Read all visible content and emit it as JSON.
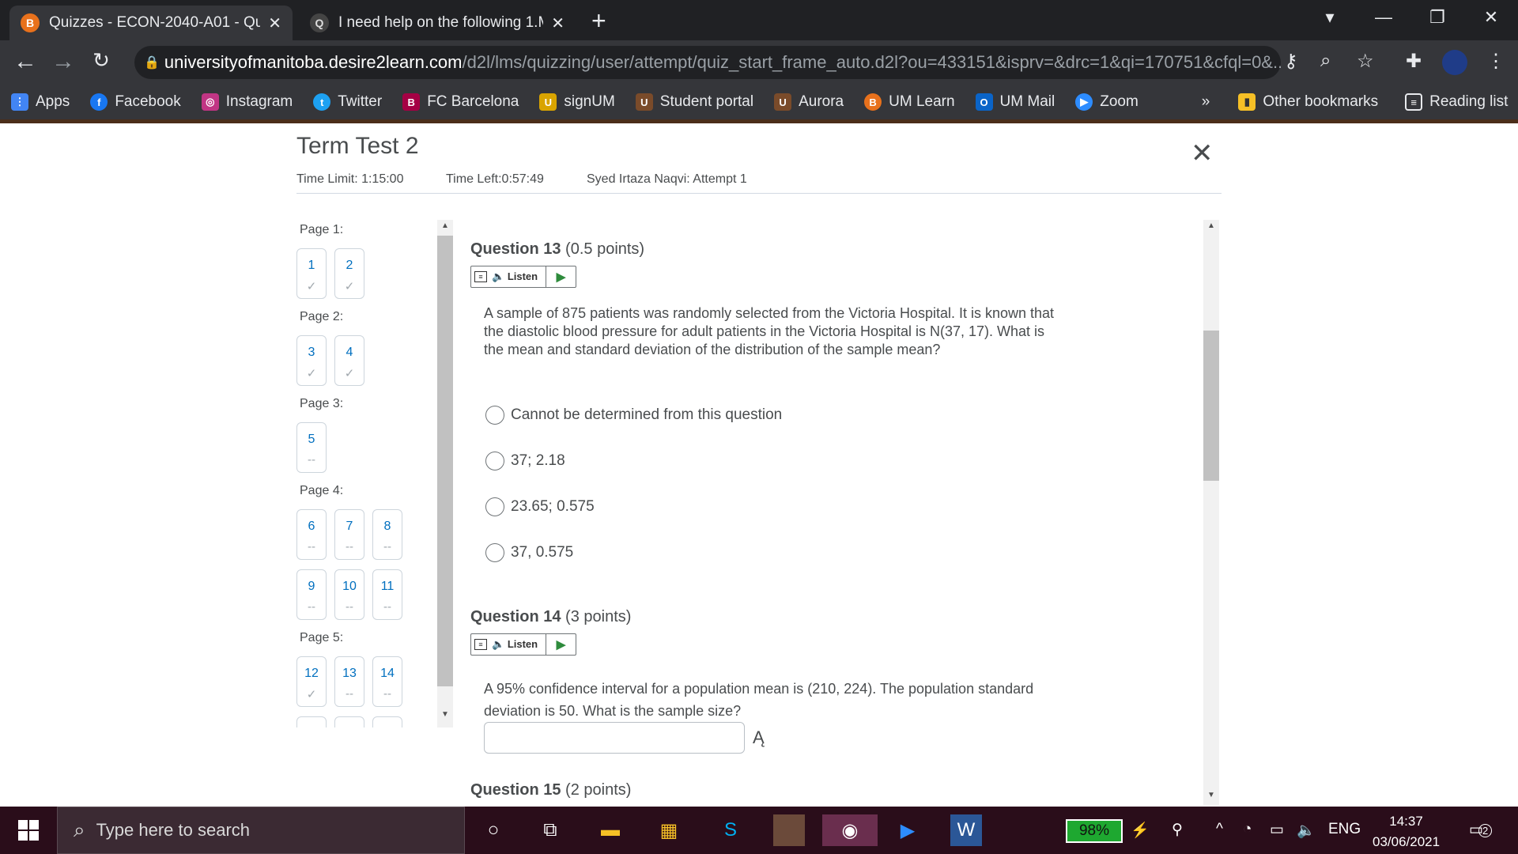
{
  "browser": {
    "tabs": [
      {
        "title": "Quizzes - ECON-2040-A01 - Quar",
        "fav": "B"
      },
      {
        "title": "I need help on the following 1.M",
        "fav": "Q"
      }
    ],
    "url_host": "universityofmanitoba.desire2learn.com",
    "url_path": "/d2l/lms/quizzing/user/attempt/quiz_start_frame_auto.d2l?ou=433151&isprv=&drc=1&qi=170751&cfql=0&...",
    "bookmarks": [
      {
        "label": "Apps",
        "icon": "apps-icon",
        "color": "#4285f4"
      },
      {
        "label": "Facebook",
        "icon": "facebook-icon",
        "color": "#1877f2"
      },
      {
        "label": "Instagram",
        "icon": "instagram-icon",
        "color": "#c13584"
      },
      {
        "label": "Twitter",
        "icon": "twitter-icon",
        "color": "#1da1f2"
      },
      {
        "label": "FC Barcelona",
        "icon": "fcb-icon",
        "color": "#a50044"
      },
      {
        "label": "signUM",
        "icon": "signum-icon",
        "color": "#d9a400"
      },
      {
        "label": "Student portal",
        "icon": "portal-icon",
        "color": "#7a4b2a"
      },
      {
        "label": "Aurora",
        "icon": "aurora-icon",
        "color": "#7a4b2a"
      },
      {
        "label": "UM Learn",
        "icon": "umlearn-icon",
        "color": "#e8711c"
      },
      {
        "label": "UM Mail",
        "icon": "outlook-icon",
        "color": "#0a64c8"
      },
      {
        "label": "Zoom",
        "icon": "zoom-icon",
        "color": "#2d8cff"
      }
    ],
    "more": "»",
    "other_bookmarks": "Other bookmarks",
    "reading_list": "Reading list"
  },
  "quiz": {
    "title": "Term Test 2",
    "time_limit": "Time Limit: 1:15:00",
    "time_left": "Time Left:0:57:49",
    "attempt": "Syed Irtaza Naqvi: Attempt 1",
    "pages": [
      {
        "label": "Page 1:"
      },
      {
        "label": "Page 2:"
      },
      {
        "label": "Page 3:"
      },
      {
        "label": "Page 4:"
      },
      {
        "label": "Page 5:"
      }
    ],
    "questions_nav": [
      {
        "n": "1",
        "status": "✓"
      },
      {
        "n": "2",
        "status": "✓"
      },
      {
        "n": "3",
        "status": "✓"
      },
      {
        "n": "4",
        "status": "✓"
      },
      {
        "n": "5",
        "status": "--"
      },
      {
        "n": "6",
        "status": "--"
      },
      {
        "n": "7",
        "status": "--"
      },
      {
        "n": "8",
        "status": "--"
      },
      {
        "n": "9",
        "status": "--"
      },
      {
        "n": "10",
        "status": "--"
      },
      {
        "n": "11",
        "status": "--"
      },
      {
        "n": "12",
        "status": "✓"
      },
      {
        "n": "13",
        "status": "--"
      },
      {
        "n": "14",
        "status": "--"
      }
    ],
    "listen_label": "Listen",
    "q13": {
      "num": "Question 13",
      "points": "(0.5 points)",
      "text": "A sample of 875 patients was randomly selected from the Victoria Hospital. It is known that the diastolic blood pressure for adult patients in the Victoria Hospital is N(37, 17). What is the mean and standard deviation of the distribution of the sample mean?",
      "options": [
        "Cannot be determined from this question",
        "37; 2.18",
        "23.65; 0.575",
        "37, 0.575"
      ]
    },
    "q14": {
      "num": "Question 14",
      "points": "(3 points)",
      "text": "A 95% confidence interval for a population mean is (210, 224). The population standard deviation is 50. What is the sample size?"
    },
    "q15": {
      "num": "Question 15",
      "points": "(2 points)"
    }
  },
  "taskbar": {
    "search_placeholder": "Type here to search",
    "battery": "98%",
    "lang": "ENG",
    "time": "14:37",
    "date": "03/06/2021",
    "notif_count": "2"
  }
}
